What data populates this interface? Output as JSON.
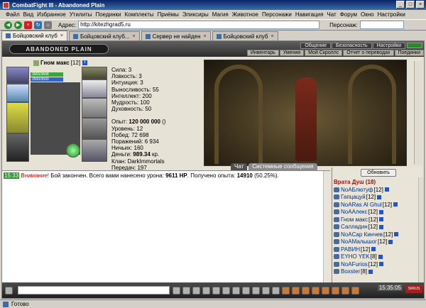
{
  "window": {
    "title": "CombatFight III - Abandoned Plain"
  },
  "menu": [
    "Файл",
    "Вид",
    "Избранное",
    "Утилиты",
    "Поединки",
    "Комплекты",
    "Приёмы",
    "Эликсиры",
    "Магия",
    "Животное",
    "Персонажи",
    "Навигация",
    "Чат",
    "Форум",
    "Окно",
    "Настройки"
  ],
  "address": {
    "label": "Адрес:",
    "value": "http://kitezhgrad5.ru",
    "persona_label": "Персонаж:"
  },
  "tabs": [
    "Бойцовский клуб",
    "Бойцовский клуб...",
    "Сервер не найден",
    "Бойцовский клуб"
  ],
  "game": {
    "logo": "ABANDONED PLAIN",
    "top_menu": [
      "Общение",
      "Безопасность",
      "Настройки"
    ],
    "bottom_menu": [
      "Инвентарь",
      "Умения",
      "Мой Скроллс",
      "Отчет о переводах",
      "Поединки"
    ]
  },
  "character": {
    "name": "Гном макс",
    "level": "[12]",
    "hp": "3665/3848",
    "mp": "3500/3500",
    "stats": [
      "Сила: 3",
      "Ловкость: 3",
      "Интуиция: 3",
      "Выносливость: 55",
      "Интеллект: 200",
      "Мудрость: 100",
      "Духовность: 50"
    ],
    "exp_label": "Опыт: ",
    "exp_value": "120 000 000",
    "exp_suffix": " ()",
    "level_line": "Уровень: 12",
    "wins": "Побед: 72 698",
    "losses": "Поражений: 6 934",
    "draws": "Ничьих: 160",
    "money_label": "Деньги: ",
    "money_value": "989.34",
    "money_suffix": " кр.",
    "clan": "Клан: DarkImmortals",
    "transfers": "Передач: 197"
  },
  "chat_tabs": [
    "Чат",
    "Системные сообщения"
  ],
  "chat": {
    "time": "15:33",
    "warn": "Внимание!",
    "text1": " Бой закончен. Всего вами нанесено урона: ",
    "damage": "9611 HP",
    "text2": ". Получено опыта: ",
    "exp": "14910",
    "text3": " (50.25%)."
  },
  "users_panel": {
    "refresh_label": "Обновить",
    "location": "Врата Душ (18)",
    "users": [
      {
        "name": "NoAБлютуф",
        "level": "[12]"
      },
      {
        "name": "Гапцацуй",
        "level": "[12]"
      },
      {
        "name": "NoARas Al Ghul",
        "level": "[12]"
      },
      {
        "name": "NoAАлекс",
        "level": "[12]"
      },
      {
        "name": "Гном макс",
        "level": "[12]"
      },
      {
        "name": "Салладин",
        "level": "[12]"
      },
      {
        "name": "NoAСар Кинчев",
        "level": "[12]"
      },
      {
        "name": "NoAМалышог",
        "level": "[12]"
      },
      {
        "name": "РАВИН",
        "level": "[12]"
      },
      {
        "name": "EYHO YEK",
        "level": "[8]"
      },
      {
        "name": "NoAFurios",
        "level": "[12]"
      },
      {
        "name": "Boxster",
        "level": "[8]"
      }
    ]
  },
  "clock": "15:35:05",
  "brand_badge": "SIRIUS",
  "status": "Готово",
  "icons": [
    "back-icon",
    "forward-icon",
    "stop-icon",
    "reload-icon",
    "home-icon"
  ]
}
